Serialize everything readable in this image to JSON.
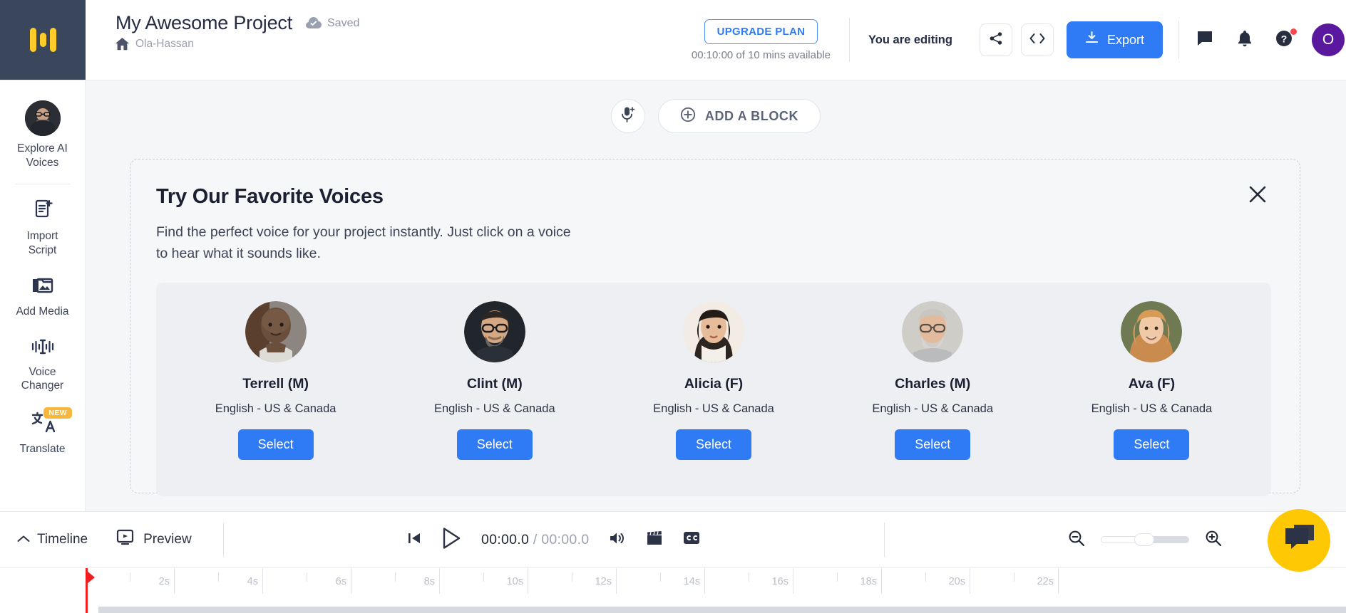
{
  "topbar": {
    "logo_name": "speaker-logo",
    "project_title": "My Awesome Project",
    "saved_label": "Saved",
    "breadcrumb_label": "Ola-Hassan",
    "upgrade_label": "UPGRADE PLAN",
    "plan_usage": "00:10:00 of 10 mins available",
    "editing_label": "You are editing",
    "share_icon": "share-icon",
    "embed_icon": "code-icon",
    "export_label": "Export",
    "comment_icon": "comment-icon",
    "bell_icon": "notification-bell-icon",
    "help_icon": "help-circle-icon",
    "avatar_initial": "O",
    "accent_blue": "#2f7bf6",
    "avatar_color": "#59189e",
    "logo_bg": "#39465c",
    "logo_accent": "#ffcc29"
  },
  "sidebar": {
    "items": [
      {
        "label": "Explore AI\nVoices",
        "line1": "Explore AI",
        "line2": "Voices",
        "icon": "voice-avatar-icon",
        "badge": ""
      },
      {
        "label": "Import Script",
        "line1": "Import",
        "line2": "Script",
        "icon": "import-script-icon",
        "badge": ""
      },
      {
        "label": "Add Media",
        "line1": "Add Media",
        "line2": "",
        "icon": "add-media-icon",
        "badge": ""
      },
      {
        "label": "Voice Changer",
        "line1": "Voice",
        "line2": "Changer",
        "icon": "voice-changer-icon",
        "badge": ""
      },
      {
        "label": "Translate",
        "line1": "Translate",
        "line2": "",
        "icon": "translate-icon",
        "badge": "NEW"
      }
    ]
  },
  "main": {
    "mic_icon": "microphone-add-icon",
    "add_block_label": "ADD A BLOCK",
    "add_block_icon": "plus-circle-icon",
    "promo": {
      "title": "Try Our Favorite Voices",
      "description": "Find the perfect voice for your project instantly. Just click on a voice to hear what it sounds like.",
      "close_icon": "close-icon",
      "select_label": "Select",
      "voices": [
        {
          "name": "Terrell (M)",
          "language": "English - US & Canada",
          "select": "Select",
          "photo": "terrell-portrait"
        },
        {
          "name": "Clint (M)",
          "language": "English - US & Canada",
          "select": "Select",
          "photo": "clint-portrait"
        },
        {
          "name": "Alicia (F)",
          "language": "English - US & Canada",
          "select": "Select",
          "photo": "alicia-portrait"
        },
        {
          "name": "Charles (M)",
          "language": "English - US & Canada",
          "select": "Select",
          "photo": "charles-portrait"
        },
        {
          "name": "Ava (F)",
          "language": "English - US & Canada",
          "select": "Select",
          "photo": "ava-portrait"
        }
      ]
    }
  },
  "footer": {
    "timeline_label": "Timeline",
    "timeline_chevron_icon": "chevron-up-icon",
    "preview_label": "Preview",
    "preview_icon": "preview-screen-icon",
    "skip_back_icon": "skip-to-start-icon",
    "play_icon": "play-icon",
    "current_time": "00:00.0",
    "time_separator": "/",
    "total_time": "00:00.0",
    "volume_icon": "volume-icon",
    "clapper_icon": "clapperboard-icon",
    "captions_icon": "closed-captions-icon",
    "zoom_out_icon": "zoom-out-icon",
    "zoom_in_icon": "zoom-in-icon",
    "zoom_value": 38,
    "chat_fab_icon": "chat-bubble-icon",
    "ruler_labels": [
      "2s",
      "4s",
      "6s",
      "8s",
      "10s",
      "12s",
      "14s",
      "16s",
      "18s",
      "20s",
      "22s"
    ]
  }
}
